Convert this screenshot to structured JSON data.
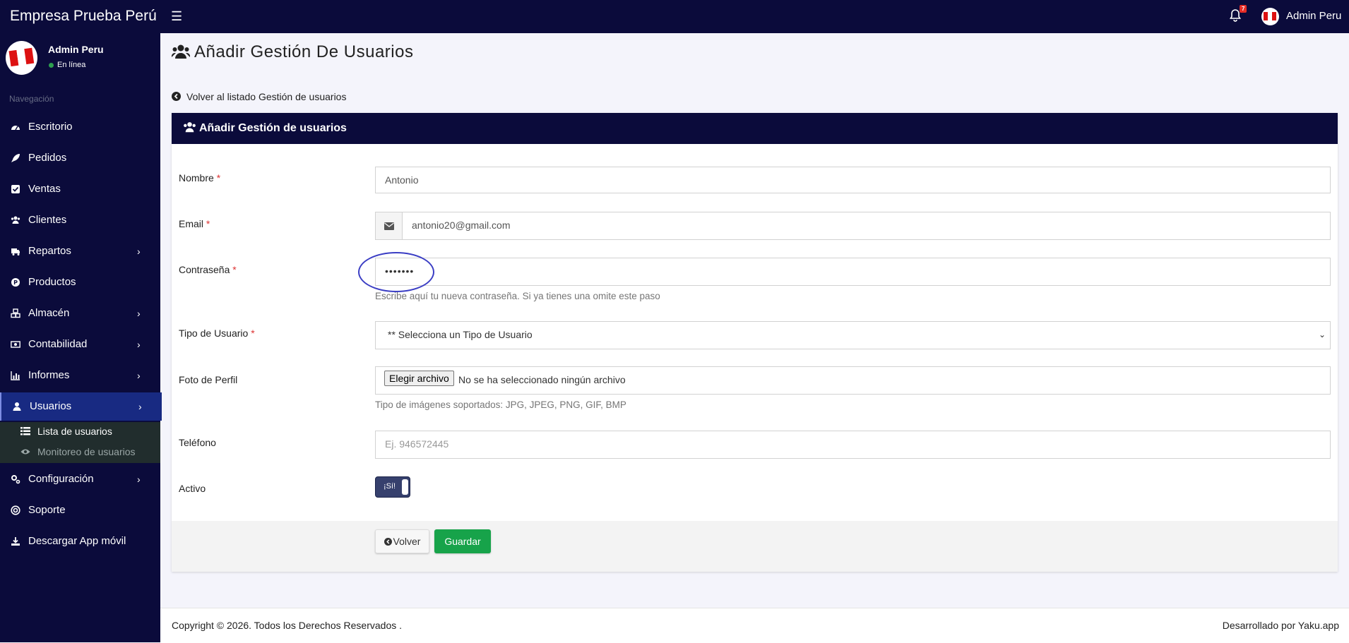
{
  "app": {
    "brand": "Empresa Prueba Perú",
    "notification_count": "7",
    "top_user": "Admin Peru"
  },
  "sidebar": {
    "user_name": "Admin Peru",
    "status": "En línea",
    "nav_heading": "Navegación",
    "items": [
      {
        "label": "Escritorio",
        "icon": "dashboard-icon"
      },
      {
        "label": "Pedidos",
        "icon": "rocket-icon"
      },
      {
        "label": "Ventas",
        "icon": "check-square-icon"
      },
      {
        "label": "Clientes",
        "icon": "users-icon"
      },
      {
        "label": "Repartos",
        "icon": "truck-icon"
      },
      {
        "label": "Productos",
        "icon": "product-p-icon"
      },
      {
        "label": "Almacén",
        "icon": "cubes-icon"
      },
      {
        "label": "Contabilidad",
        "icon": "money-icon"
      },
      {
        "label": "Informes",
        "icon": "bar-chart-icon"
      },
      {
        "label": "Usuarios",
        "icon": "user-icon"
      },
      {
        "label": "Configuración",
        "icon": "cogs-icon"
      },
      {
        "label": "Soporte",
        "icon": "life-ring-icon"
      },
      {
        "label": "Descargar App móvil",
        "icon": "download-icon"
      }
    ],
    "submenu": [
      {
        "label": "Lista de usuarios",
        "icon": "list-icon"
      },
      {
        "label": "Monitoreo de usuarios",
        "icon": "eye-icon"
      }
    ]
  },
  "page": {
    "title": "Añadir Gestión De Usuarios",
    "back_link": "Volver al listado Gestión de usuarios",
    "card_title": "Añadir Gestión de usuarios"
  },
  "form": {
    "nombre": {
      "label": "Nombre",
      "value": "Antonio"
    },
    "email": {
      "label": "Email",
      "value": "antonio20@gmail.com"
    },
    "password": {
      "label": "Contraseña",
      "value": "•••••••",
      "help": "Escribe aquí tu nueva contraseña. Si ya tienes una omite este paso"
    },
    "tipo": {
      "label": "Tipo de Usuario",
      "value": "** Selecciona un Tipo de Usuario"
    },
    "foto": {
      "label": "Foto de Perfil",
      "button": "Elegir archivo",
      "file_status": "No se ha seleccionado ningún archivo",
      "help": "Tipo de imágenes soportados: JPG, JPEG, PNG, GIF, BMP"
    },
    "telefono": {
      "label": "Teléfono",
      "placeholder": "Ej. 946572445"
    },
    "activo": {
      "label": "Activo",
      "toggle_text": "¡Sí!",
      "checked": true
    },
    "required_mark": "*"
  },
  "actions": {
    "back": "Volver",
    "save": "Guardar"
  },
  "footer": {
    "copyright": "Copyright © 2026. Todos los Derechos Reservados .",
    "developer": "Desarrollado por Yaku.app"
  },
  "colors": {
    "navy": "#0b0b3b",
    "active_nav": "#182a82",
    "save_green": "#17a34a",
    "annotation": "#3b3ec4"
  }
}
